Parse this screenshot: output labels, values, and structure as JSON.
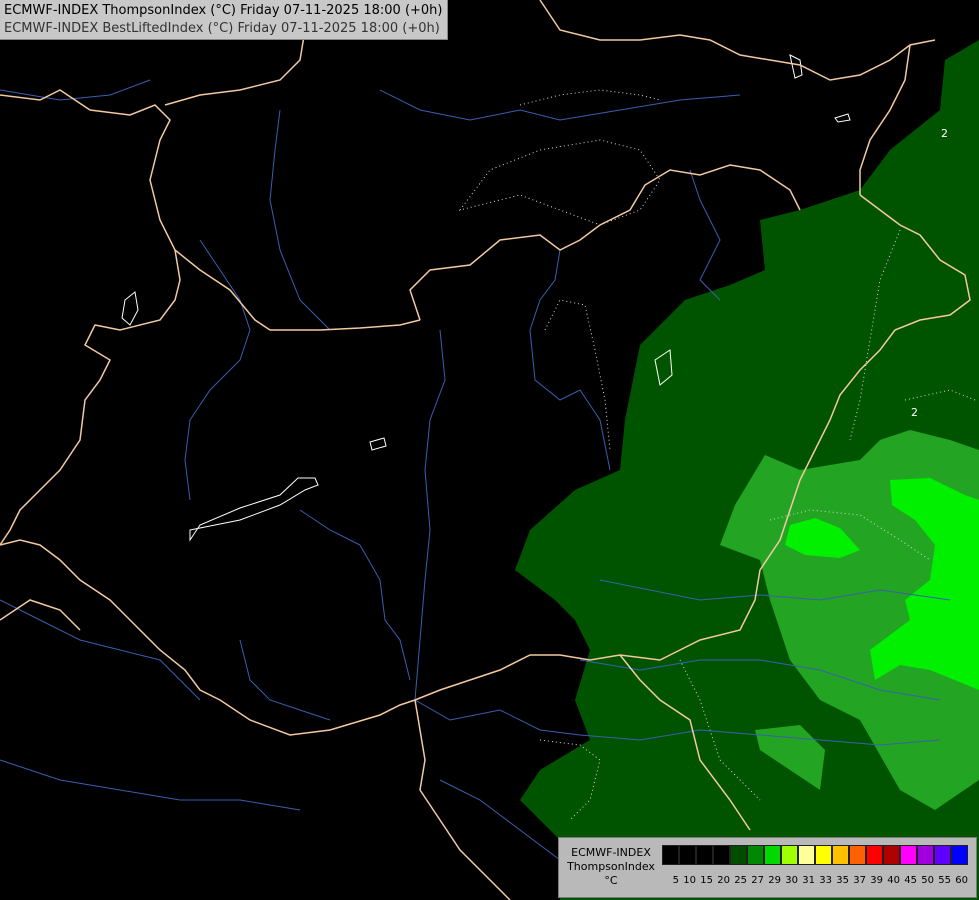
{
  "header": {
    "line1": "ECMWF-INDEX ThompsonIndex (°C) Friday 07-11-2025 18:00 (+0h)",
    "line2": "ECMWF-INDEX BestLiftedIndex (°C) Friday 07-11-2025 18:00 (+0h)"
  },
  "map": {
    "contour_labels": [
      "2",
      "2"
    ]
  },
  "legend": {
    "model": "ECMWF-INDEX",
    "parameter": "ThompsonIndex",
    "unit": "°C",
    "levels": [
      {
        "label": "5",
        "color": "#000000"
      },
      {
        "label": "10",
        "color": "#000000"
      },
      {
        "label": "15",
        "color": "#000000"
      },
      {
        "label": "20",
        "color": "#000000"
      },
      {
        "label": "25",
        "color": "#004d00"
      },
      {
        "label": "27",
        "color": "#008800"
      },
      {
        "label": "29",
        "color": "#00d800"
      },
      {
        "label": "30",
        "color": "#a0ff00"
      },
      {
        "label": "31",
        "color": "#ffff99"
      },
      {
        "label": "33",
        "color": "#ffff00"
      },
      {
        "label": "35",
        "color": "#ffc000"
      },
      {
        "label": "37",
        "color": "#ff6000"
      },
      {
        "label": "39",
        "color": "#ff0000"
      },
      {
        "label": "40",
        "color": "#b00000"
      },
      {
        "label": "45",
        "color": "#ff00ff"
      },
      {
        "label": "50",
        "color": "#a000e0"
      },
      {
        "label": "55",
        "color": "#6000ff"
      },
      {
        "label": "60",
        "color": "#0000ff"
      }
    ]
  },
  "colors": {
    "background": "#000000",
    "border": "#f2c9a0",
    "river": "#3a5fb0",
    "field_low": "#005a00",
    "field_mid": "#1ea01e",
    "field_high": "#00ee00"
  }
}
